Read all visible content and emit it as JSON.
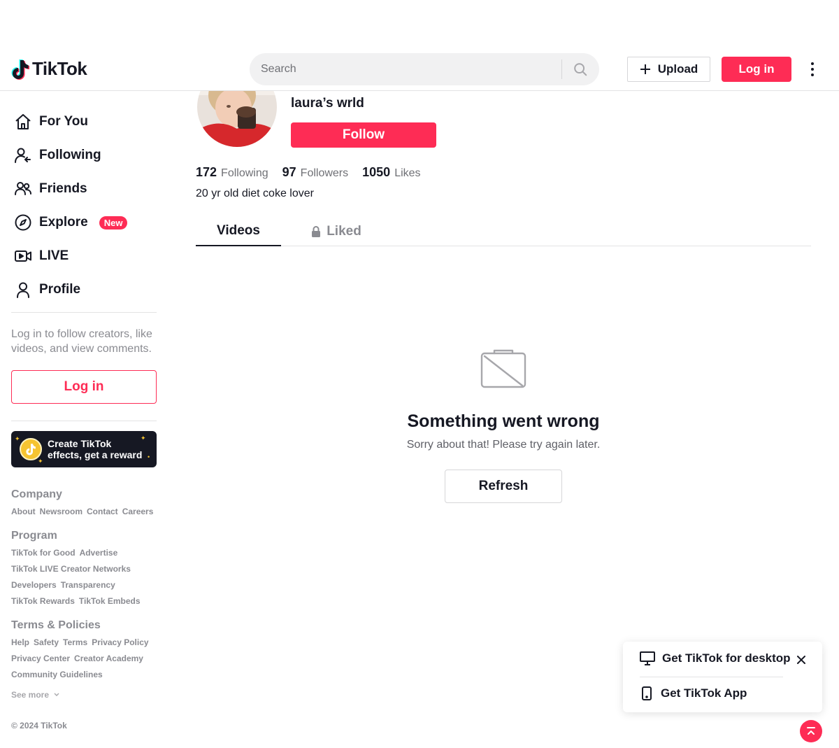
{
  "header": {
    "logo_text": "TikTok",
    "search_placeholder": "Search",
    "upload_label": "Upload",
    "login_label": "Log in"
  },
  "sidebar": {
    "items": [
      {
        "label": "For You",
        "icon": "home-icon"
      },
      {
        "label": "Following",
        "icon": "following-icon"
      },
      {
        "label": "Friends",
        "icon": "friends-icon"
      },
      {
        "label": "Explore",
        "icon": "compass-icon",
        "badge": "New"
      },
      {
        "label": "LIVE",
        "icon": "live-icon"
      },
      {
        "label": "Profile",
        "icon": "profile-icon"
      }
    ],
    "login_prompt": "Log in to follow creators, like videos, and view comments.",
    "login_label": "Log in",
    "effects_text": "Create TikTok effects, get a reward"
  },
  "footer": {
    "company_title": "Company",
    "company_links": [
      "About",
      "Newsroom",
      "Contact",
      "Careers"
    ],
    "program_title": "Program",
    "program_links": [
      "TikTok for Good",
      "Advertise",
      "TikTok LIVE Creator Networks",
      "Developers",
      "Transparency",
      "TikTok Rewards",
      "TikTok Embeds"
    ],
    "terms_title": "Terms & Policies",
    "terms_links": [
      "Help",
      "Safety",
      "Terms",
      "Privacy Policy",
      "Privacy Center",
      "Creator Academy",
      "Community Guidelines"
    ],
    "see_more": "See more",
    "copyright": "© 2024 TikTok"
  },
  "profile": {
    "name": "laura’s wrld",
    "follow_label": "Follow",
    "following_count": "172",
    "following_label": "Following",
    "followers_count": "97",
    "followers_label": "Followers",
    "likes_count": "1050",
    "likes_label": "Likes",
    "bio": "20 yr old diet coke lover"
  },
  "tabs": {
    "videos": "Videos",
    "liked": "Liked"
  },
  "error": {
    "title": "Something went wrong",
    "subtitle": "Sorry about that! Please try again later.",
    "refresh_label": "Refresh"
  },
  "app_popup": {
    "desktop_label": "Get TikTok for desktop",
    "app_label": "Get TikTok App"
  },
  "colors": {
    "brand": "#fe2c55",
    "text": "#161823",
    "muted": "#8a8b91"
  }
}
